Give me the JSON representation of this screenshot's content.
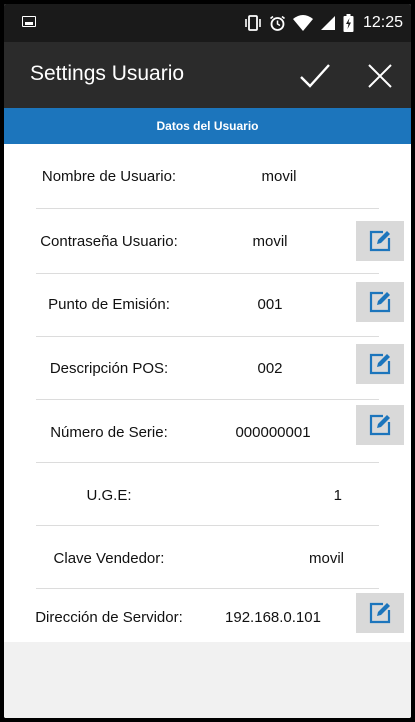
{
  "status_bar": {
    "time": "12:25",
    "icons": [
      "image-notification-icon",
      "vibrate-icon",
      "alarm-icon",
      "wifi-icon",
      "signal-icon",
      "battery-charging-icon"
    ]
  },
  "app_bar": {
    "title": "Settings Usuario",
    "actions": [
      {
        "name": "confirm-button",
        "icon": "check-icon"
      },
      {
        "name": "close-button",
        "icon": "close-icon"
      }
    ]
  },
  "section": {
    "title": "Datos del Usuario"
  },
  "fields": [
    {
      "label": "Nombre de Usuario:",
      "value": "movil",
      "editable": false
    },
    {
      "label": "Contraseña Usuario:",
      "value": "movil",
      "editable": true
    },
    {
      "label": "Punto de Emisión:",
      "value": "001",
      "editable": true
    },
    {
      "label": "Descripción POS:",
      "value": "002",
      "editable": true
    },
    {
      "label": "Número de Serie:",
      "value": "000000001",
      "editable": true
    },
    {
      "label": "U.G.E:",
      "value": "1",
      "editable": false
    },
    {
      "label": "Clave Vendedor:",
      "value": "movil",
      "editable": false
    },
    {
      "label": "Dirección de Servidor:",
      "value": "192.168.0.101",
      "editable": true
    }
  ],
  "colors": {
    "app_bar": "#2b2b2b",
    "section_header": "#1c75bc",
    "edit_icon": "#1c75bc",
    "edit_button_bg": "#d9d9d9"
  }
}
